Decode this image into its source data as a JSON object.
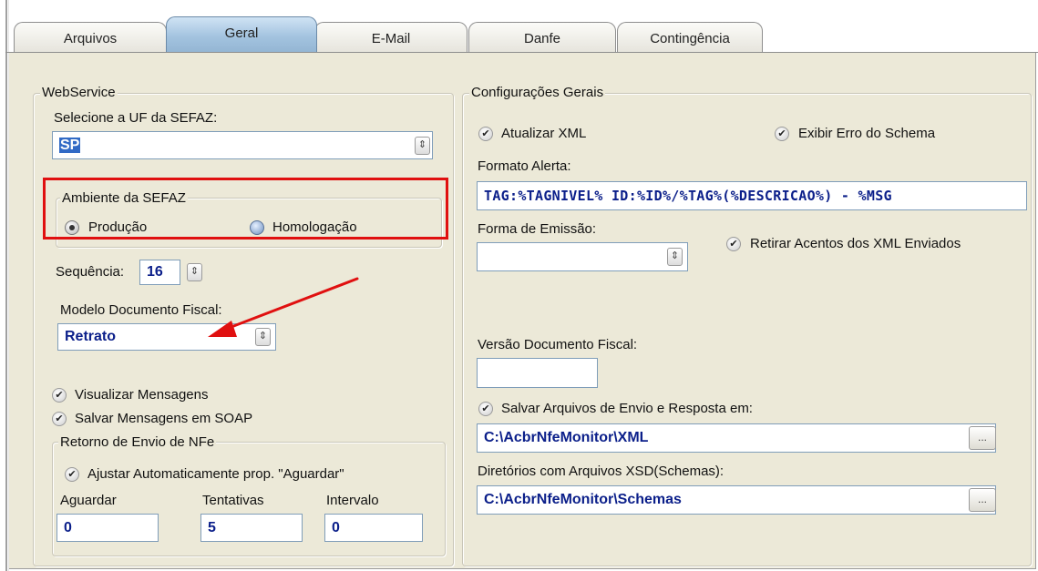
{
  "tabs": [
    {
      "label": "Arquivos"
    },
    {
      "label": "Geral"
    },
    {
      "label": "E-Mail"
    },
    {
      "label": "Danfe"
    },
    {
      "label": "Contingência"
    }
  ],
  "active_tab": "Geral",
  "webservice": {
    "legend": "WebService",
    "uf_label": "Selecione a UF da SEFAZ:",
    "uf_value": "SP",
    "ambiente": {
      "legend": "Ambiente da SEFAZ",
      "producao_label": "Produção",
      "homologacao_label": "Homologação",
      "selected": "Produção"
    },
    "sequencia_label": "Sequência:",
    "sequencia_value": "16",
    "modelo_label": "Modelo Documento Fiscal:",
    "modelo_value": "Retrato",
    "visualizar_mensagens_label": "Visualizar Mensagens",
    "visualizar_mensagens_checked": true,
    "salvar_soap_label": "Salvar Mensagens em SOAP",
    "salvar_soap_checked": true,
    "retorno": {
      "legend": "Retorno de Envio de NFe",
      "ajustar_label": "Ajustar Automaticamente prop. \"Aguardar\"",
      "ajustar_checked": true,
      "aguardar_label": "Aguardar",
      "aguardar_value": "0",
      "tentativas_label": "Tentativas",
      "tentativas_value": "5",
      "intervalo_label": "Intervalo",
      "intervalo_value": "0"
    }
  },
  "config_gerais": {
    "legend": "Configurações Gerais",
    "atualizar_xml_label": "Atualizar XML",
    "atualizar_xml_checked": true,
    "exibir_erro_label": "Exibir Erro do Schema",
    "exibir_erro_checked": true,
    "formato_alerta_label": "Formato Alerta:",
    "formato_alerta_value": "TAG:%TAGNIVEL% ID:%ID%/%TAG%(%DESCRICAO%) - %MSG",
    "forma_emissao_label": "Forma de Emissão:",
    "forma_emissao_value": "",
    "retirar_acentos_label": "Retirar Acentos dos XML Enviados",
    "retirar_acentos_checked": true,
    "versao_label": "Versão Documento Fiscal:",
    "versao_value": "",
    "salvar_arquivos_label": "Salvar Arquivos de Envio e Resposta em:",
    "salvar_arquivos_checked": true,
    "xml_path": "C:\\AcbrNfeMonitor\\XML",
    "schemas_label": "Diretórios com Arquivos XSD(Schemas):",
    "schemas_path": "C:\\AcbrNfeMonitor\\Schemas",
    "browse_label": "..."
  },
  "icons": {
    "check": "✔",
    "spin": "⇕"
  },
  "colors": {
    "highlight_box": "#e01010",
    "annotation_arrow": "#e01010",
    "field_text": "#0b1f8a",
    "panel_bg": "#ece9d8",
    "active_tab": "#a3c3df"
  }
}
